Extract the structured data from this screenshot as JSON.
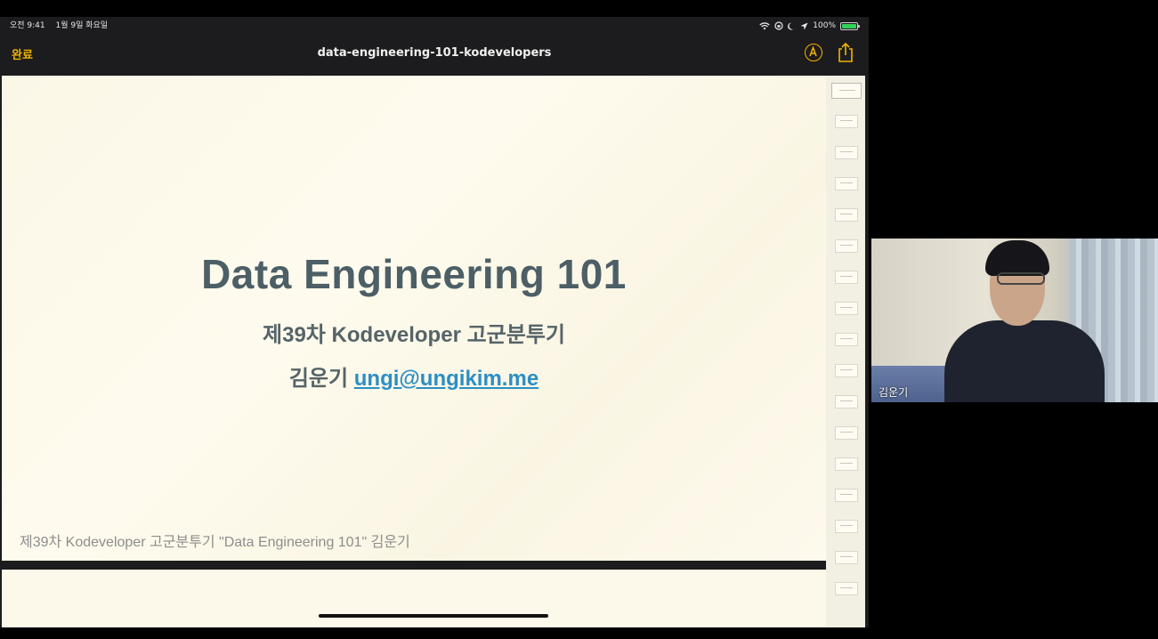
{
  "status_bar": {
    "time": "오전 9:41",
    "date": "1월 9일 화요일",
    "battery_label": "100%"
  },
  "nav": {
    "done_label": "완료",
    "document_title": "data-engineering-101-kodevelopers",
    "markup_icon": "markup-pen-icon",
    "share_icon": "share-icon"
  },
  "slide": {
    "title": "Data Engineering 101",
    "subtitle": "제39차 Kodeveloper 고군분투기",
    "author_name": "김운기",
    "author_email": "ungi@ungikim.me",
    "footer": "제39차 Kodeveloper 고군분투기 \"Data Engineering 101\" 김운기"
  },
  "video": {
    "participant_name": "김운기"
  },
  "colors": {
    "accent": "#f2b300",
    "slide_title": "#4d5f66",
    "link": "#2b8fc4",
    "battery": "#30d158"
  }
}
